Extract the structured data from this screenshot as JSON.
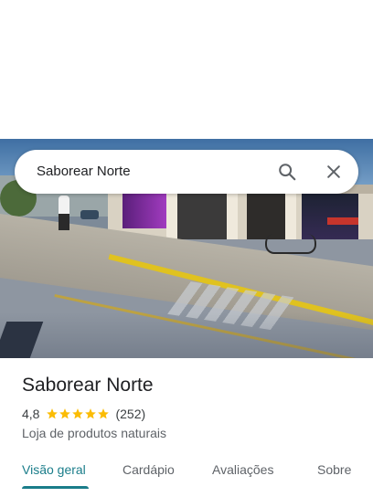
{
  "search": {
    "query": "Saborear Norte"
  },
  "place": {
    "name": "Saborear Norte",
    "rating": "4,8",
    "rating_value": 4.8,
    "review_count": "(252)",
    "category": "Loja de produtos naturais"
  },
  "tabs": [
    {
      "label": "Visão geral",
      "active": true
    },
    {
      "label": "Cardápio",
      "active": false
    },
    {
      "label": "Avaliações",
      "active": false
    },
    {
      "label": "Sobre",
      "active": false
    }
  ],
  "colors": {
    "accent": "#1a7d8a",
    "star": "#fbbc04",
    "text": "#202124"
  },
  "icons": {
    "search": "search-icon",
    "close": "close-icon",
    "star": "star-icon"
  }
}
